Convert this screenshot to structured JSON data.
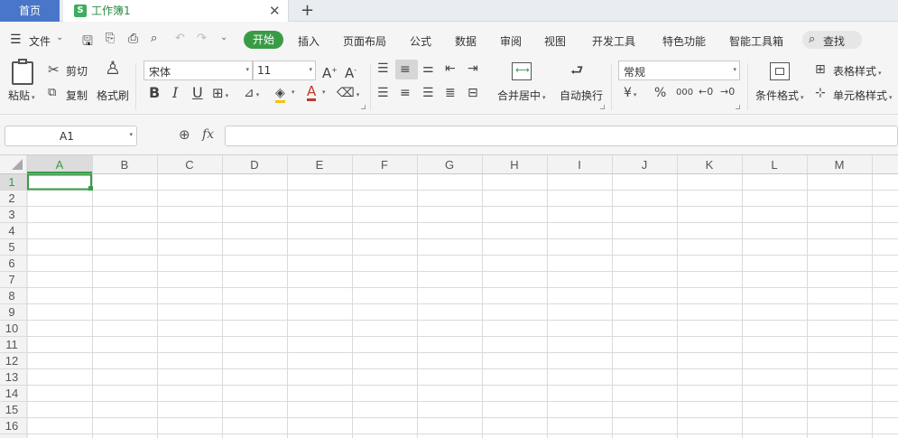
{
  "tabs": {
    "home": "首页",
    "workbook": "工作簿1",
    "workbook_icon": "S"
  },
  "menu": {
    "file": "文件",
    "items": [
      "开始",
      "插入",
      "页面布局",
      "公式",
      "数据",
      "审阅",
      "视图",
      "开发工具",
      "特色功能",
      "智能工具箱"
    ],
    "search": "查找"
  },
  "ribbon": {
    "paste": "粘贴",
    "cut": "剪切",
    "copy": "复制",
    "format_painter": "格式刷",
    "font_name": "宋体",
    "font_size": "11",
    "bold": "B",
    "italic": "I",
    "underline": "U",
    "merge": "合并居中",
    "wrap": "自动换行",
    "number_format": "常规",
    "currency": "¥",
    "percent": "%",
    "thousands": "000",
    "cond_format": "条件格式",
    "table_style": "表格样式",
    "cell_style": "单元格样式"
  },
  "formula_bar": {
    "cell_ref": "A1",
    "fx": "fx",
    "value": ""
  },
  "grid": {
    "columns": [
      "A",
      "B",
      "C",
      "D",
      "E",
      "F",
      "G",
      "H",
      "I",
      "J",
      "K",
      "L",
      "M"
    ],
    "rows": [
      "1",
      "2",
      "3",
      "4",
      "5",
      "6",
      "7",
      "8",
      "9",
      "10",
      "11",
      "12",
      "13",
      "14",
      "15",
      "16"
    ],
    "selected": "A1"
  },
  "colors": {
    "tab_home": "#4a76c9",
    "start_active": "#3a9b47",
    "selection": "#3a9b47",
    "workbook_text": "#2b8a3e"
  }
}
